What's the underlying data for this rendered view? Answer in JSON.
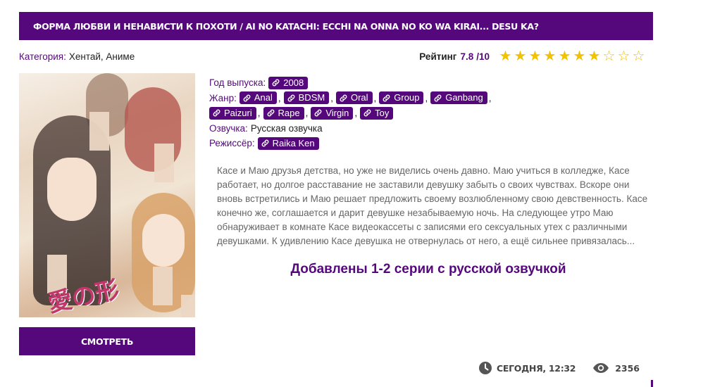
{
  "title": "ФОРМА ЛЮБВИ И НЕНАВИСТИ К ПОХОТИ / AI NO KATACHI: ECCHI NA ONNA NO KO WA KIRAI... DESU KA?",
  "category": {
    "label": "Категория:",
    "value": "Хентай, Аниме"
  },
  "rating": {
    "label": "Рейтинг",
    "value": "7.8",
    "max": "/10",
    "stars_full": 7,
    "stars_total": 10,
    "star_color": "#f2c200"
  },
  "poster": {
    "logo_text": "愛の形"
  },
  "watch_button": "СМОТРЕТЬ",
  "info": {
    "year": {
      "label": "Год выпуска:",
      "value": "2008"
    },
    "genre": {
      "label": "Жанр:",
      "tags": [
        "Anal",
        "BDSM",
        "Oral",
        "Group",
        "Ganbang",
        "Paizuri",
        "Rape",
        "Virgin",
        "Toy"
      ]
    },
    "voice": {
      "label": "Озвучка:",
      "value": "Русская озвучка"
    },
    "director": {
      "label": "Режиссёр:",
      "value": "Raika Ken"
    }
  },
  "description": "Касе и Маю друзья детства, но уже не виделись очень давно. Маю учиться в колледже, Касе работает, но долгое расставание не заставили девушку забыть о своих чувствах. Вскоре они вновь встретились и Маю решает предложить своему возлюбленному свою девственность. Касе конечно же, соглашается и дарит девушке незабываемую ночь. На следующее утро Маю обнаруживает в комнате Касе видеокассеты с записями его сексуальных утех с различными девушками. К удивлению Касе девушка не отвернулась от него, а ещё сильнее привязалась...",
  "added_note": "Добавлены 1-2 серии с русской озвучкой",
  "footer": {
    "date": "СЕГОДНЯ, 12:32",
    "views": "2356",
    "clock_icon": "clock-icon",
    "eye_icon": "eye-icon"
  },
  "colors": {
    "accent": "#55087b",
    "star": "#f2c200",
    "desc_text": "#666666"
  }
}
